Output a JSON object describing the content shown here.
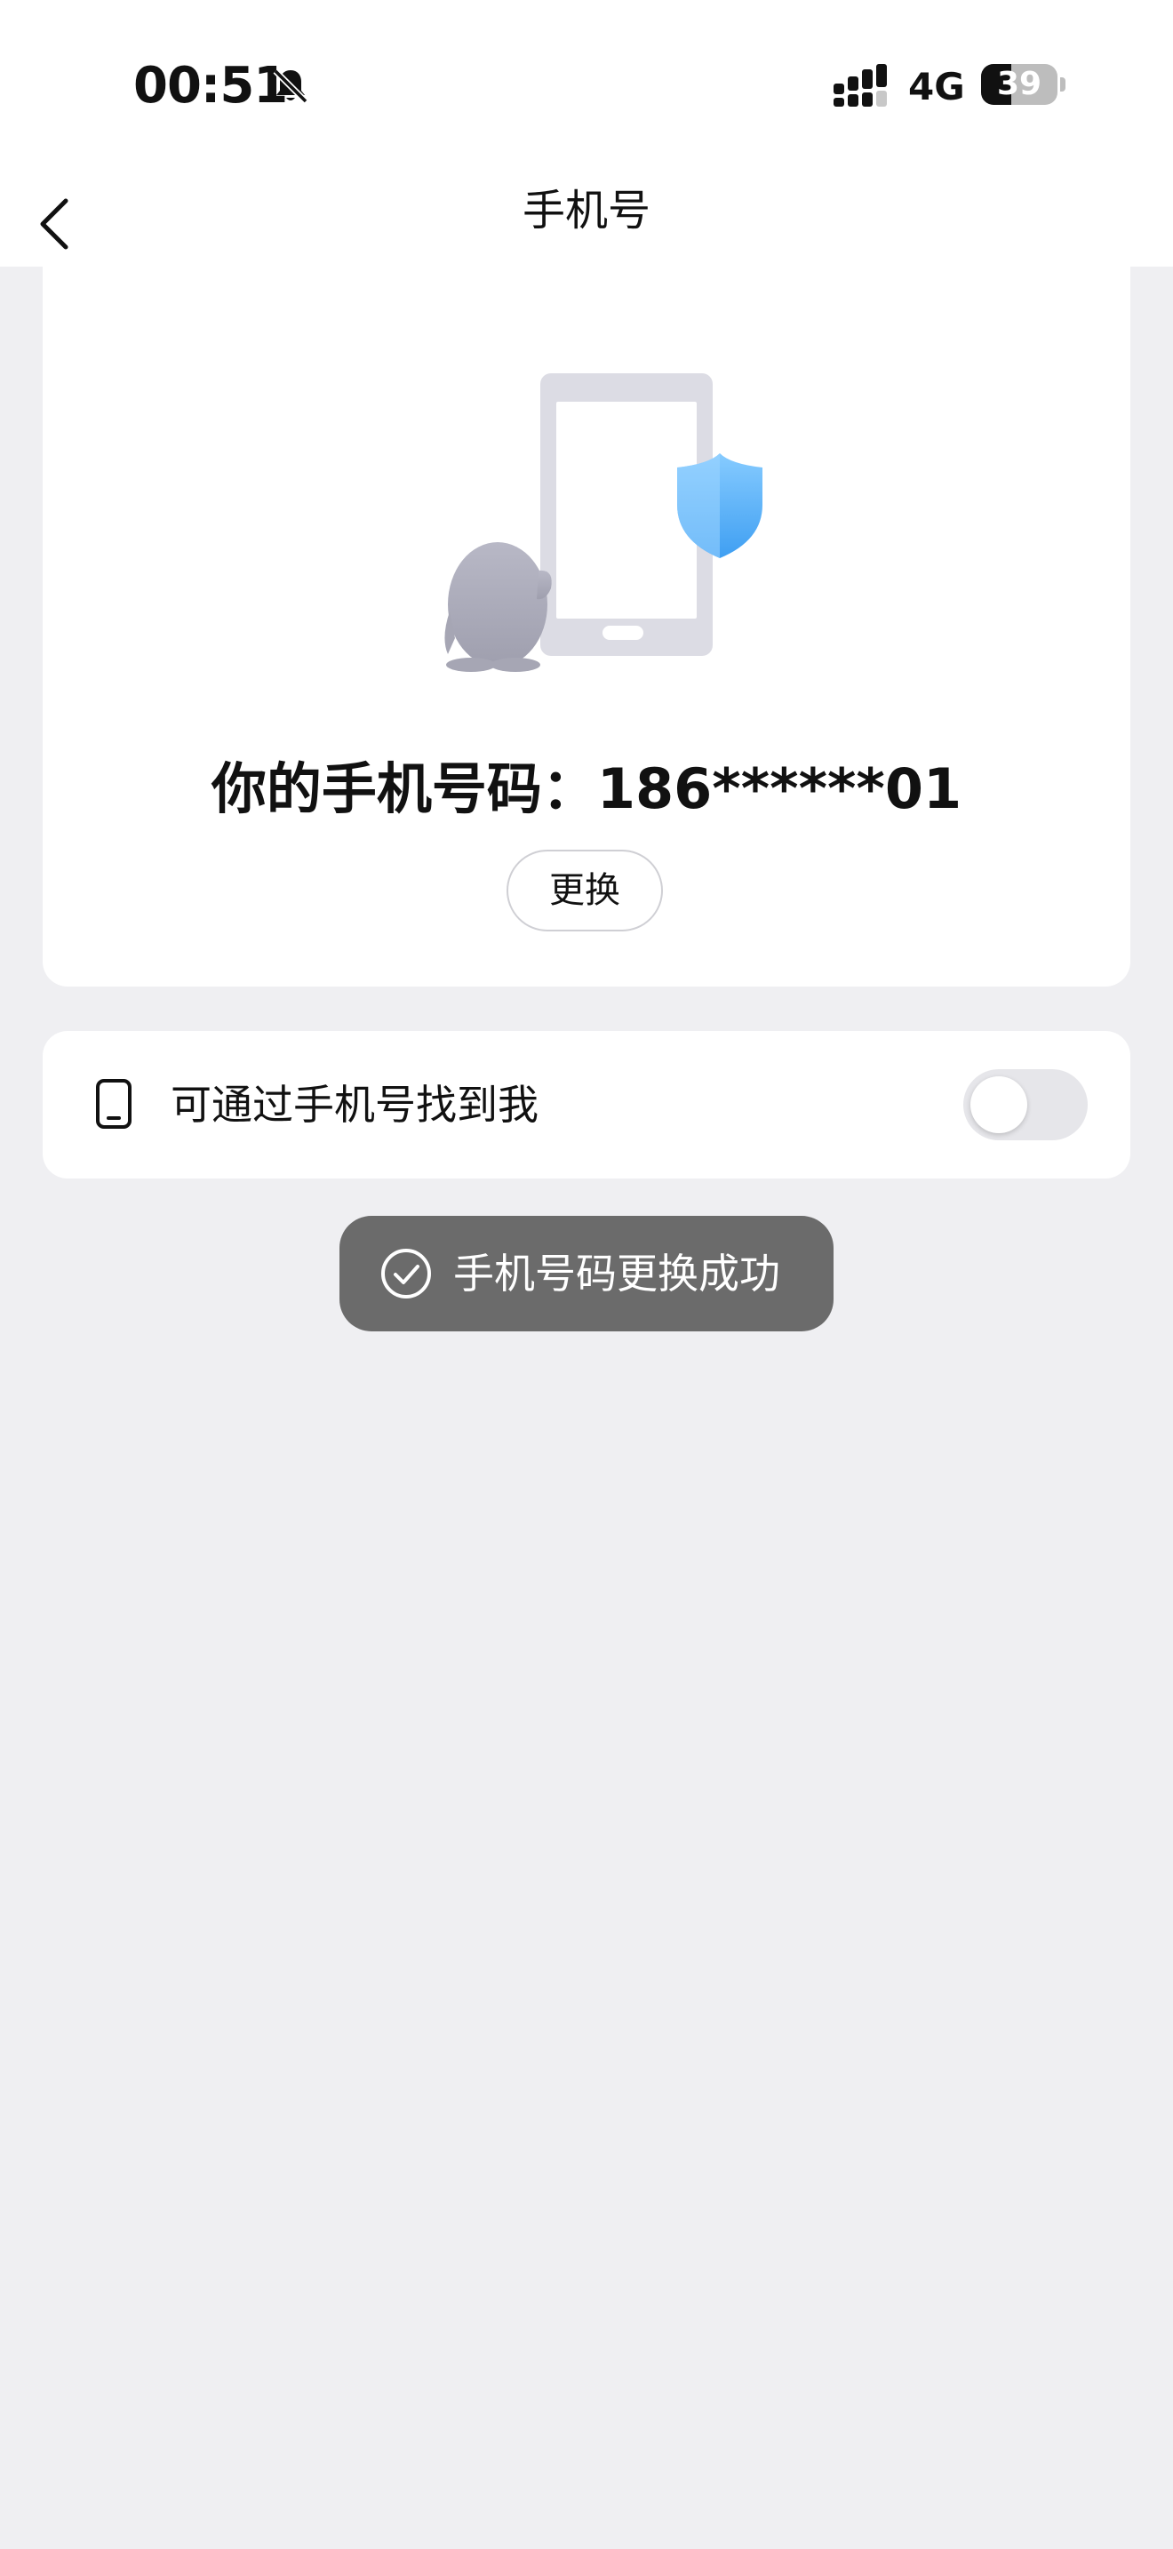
{
  "status_bar": {
    "time": "00:51",
    "network": "4G",
    "battery_level": "39",
    "battery_fraction": 0.39,
    "icons": [
      "bell-muted-icon",
      "signal-icon",
      "battery-icon"
    ]
  },
  "nav": {
    "title": "手机号",
    "back_icon": "chevron-left-icon"
  },
  "phone_card": {
    "illustration": "phone-shield-penguin-illustration",
    "number_label": "你的手机号码：186******01",
    "change_button": "更换"
  },
  "setting": {
    "icon": "phone-icon",
    "label": "可通过手机号找到我",
    "toggle_on": false
  },
  "toast": {
    "icon": "check-circle-icon",
    "message": "手机号码更换成功"
  },
  "colors": {
    "background": "#efeff2",
    "card": "#ffffff",
    "toast": "#6b6b6b",
    "shield": "#4aa8f5",
    "toggle_off": "#e6e6ea"
  }
}
